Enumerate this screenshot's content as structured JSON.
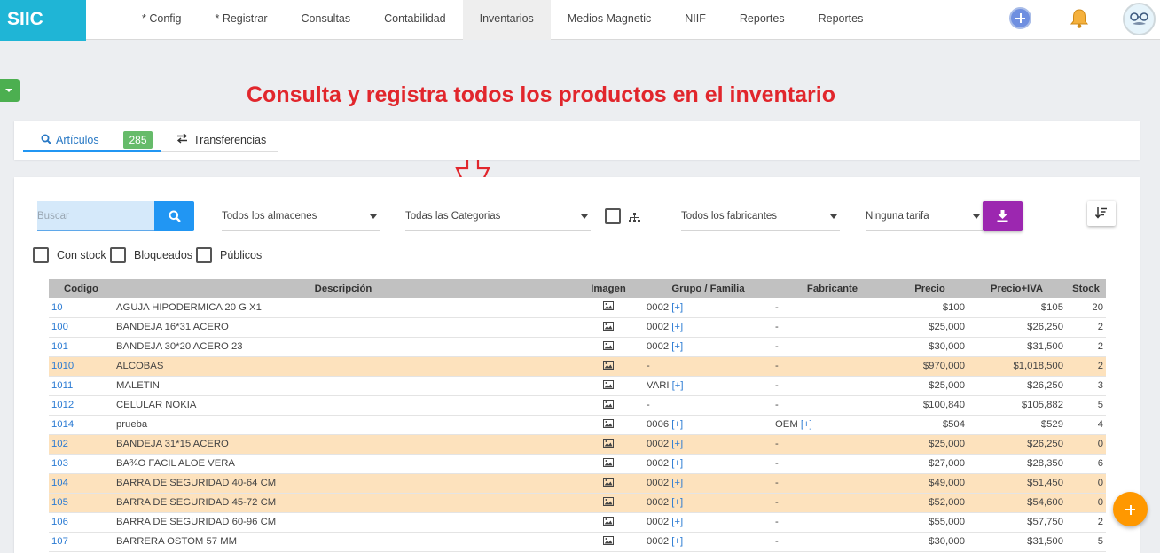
{
  "app": {
    "logo": "SIIC"
  },
  "nav": [
    {
      "label": "* Config",
      "active": false
    },
    {
      "label": "* Registrar",
      "active": false
    },
    {
      "label": "Consultas",
      "active": false
    },
    {
      "label": "Contabilidad",
      "active": false
    },
    {
      "label": "Inventarios",
      "active": true
    },
    {
      "label": "Medios Magnetic",
      "active": false
    },
    {
      "label": "NIIF",
      "active": false
    },
    {
      "label": "Reportes",
      "active": false
    },
    {
      "label": "Reportes",
      "active": false
    }
  ],
  "annotation": {
    "headline": "Consulta y registra todos los productos en el inventario",
    "color": "#e1262c"
  },
  "tabs": {
    "articulos": {
      "label": "Artículos",
      "count": "285"
    },
    "transferencias": {
      "label": "Transferencias"
    }
  },
  "toolbar": {
    "search_placeholder": "Buscar",
    "almacenes": "Todos los almacenes",
    "categorias": "Todas las Categorias",
    "fabricantes": "Todos los fabricantes",
    "tarifa": "Ninguna tarifa"
  },
  "filters": {
    "con_stock": "Con stock",
    "bloqueados": "Bloqueados",
    "publicos": "Públicos"
  },
  "table": {
    "headers": [
      "Codigo",
      "Descripción",
      "Imagen",
      "Grupo / Familia",
      "Fabricante",
      "Precio",
      "Precio+IVA",
      "Stock"
    ],
    "rows": [
      {
        "code": "10",
        "desc": "AGUJA HIPODERMICA 20 G X1",
        "group": "0002",
        "group_link": "[+]",
        "maker": "-",
        "maker_link": "",
        "price": "$100",
        "price_iva": "$105",
        "stock": "20",
        "highlight": false
      },
      {
        "code": "100",
        "desc": "BANDEJA 16*31 ACERO",
        "group": "0002",
        "group_link": "[+]",
        "maker": "-",
        "maker_link": "",
        "price": "$25,000",
        "price_iva": "$26,250",
        "stock": "2",
        "highlight": false
      },
      {
        "code": "101",
        "desc": "BANDEJA 30*20 ACERO 23",
        "group": "0002",
        "group_link": "[+]",
        "maker": "-",
        "maker_link": "",
        "price": "$30,000",
        "price_iva": "$31,500",
        "stock": "2",
        "highlight": false
      },
      {
        "code": "1010",
        "desc": "ALCOBAS",
        "group": "-",
        "group_link": "",
        "maker": "-",
        "maker_link": "",
        "price": "$970,000",
        "price_iva": "$1,018,500",
        "stock": "2",
        "highlight": true
      },
      {
        "code": "1011",
        "desc": "MALETIN",
        "group": "VARI",
        "group_link": "[+]",
        "maker": "-",
        "maker_link": "",
        "price": "$25,000",
        "price_iva": "$26,250",
        "stock": "3",
        "highlight": false
      },
      {
        "code": "1012",
        "desc": "CELULAR NOKIA",
        "group": "-",
        "group_link": "",
        "maker": "-",
        "maker_link": "",
        "price": "$100,840",
        "price_iva": "$105,882",
        "stock": "5",
        "highlight": false
      },
      {
        "code": "1014",
        "desc": "prueba",
        "group": "0006",
        "group_link": "[+]",
        "maker": "OEM",
        "maker_link": "[+]",
        "price": "$504",
        "price_iva": "$529",
        "stock": "4",
        "highlight": false
      },
      {
        "code": "102",
        "desc": "BANDEJA 31*15 ACERO",
        "group": "0002",
        "group_link": "[+]",
        "maker": "-",
        "maker_link": "",
        "price": "$25,000",
        "price_iva": "$26,250",
        "stock": "0",
        "highlight": true
      },
      {
        "code": "103",
        "desc": "BA¾O FACIL ALOE VERA",
        "group": "0002",
        "group_link": "[+]",
        "maker": "-",
        "maker_link": "",
        "price": "$27,000",
        "price_iva": "$28,350",
        "stock": "6",
        "highlight": false
      },
      {
        "code": "104",
        "desc": "BARRA DE SEGURIDAD 40-64 CM",
        "group": "0002",
        "group_link": "[+]",
        "maker": "-",
        "maker_link": "",
        "price": "$49,000",
        "price_iva": "$51,450",
        "stock": "0",
        "highlight": true
      },
      {
        "code": "105",
        "desc": "BARRA DE SEGURIDAD 45-72 CM",
        "group": "0002",
        "group_link": "[+]",
        "maker": "-",
        "maker_link": "",
        "price": "$52,000",
        "price_iva": "$54,600",
        "stock": "0",
        "highlight": true
      },
      {
        "code": "106",
        "desc": "BARRA DE SEGURIDAD 60-96 CM",
        "group": "0002",
        "group_link": "[+]",
        "maker": "-",
        "maker_link": "",
        "price": "$55,000",
        "price_iva": "$57,750",
        "stock": "2",
        "highlight": false
      },
      {
        "code": "107",
        "desc": "BARRERA OSTOM 57 MM",
        "group": "0002",
        "group_link": "[+]",
        "maker": "-",
        "maker_link": "",
        "price": "$30,000",
        "price_iva": "$31,500",
        "stock": "5",
        "highlight": false
      }
    ]
  },
  "colors": {
    "logo_bg": "#1fb5d6",
    "primary": "#2196f3",
    "download": "#9c27b0",
    "fab": "#ff9800",
    "row_highlight": "#fde2bd",
    "badge": "#66bb6a"
  },
  "icons": [
    "plus-circle-icon",
    "bell-icon",
    "avatar",
    "search-icon",
    "swap-icon",
    "hierarchy-icon",
    "download-icon",
    "sort-icon",
    "image-icon",
    "add-icon"
  ]
}
